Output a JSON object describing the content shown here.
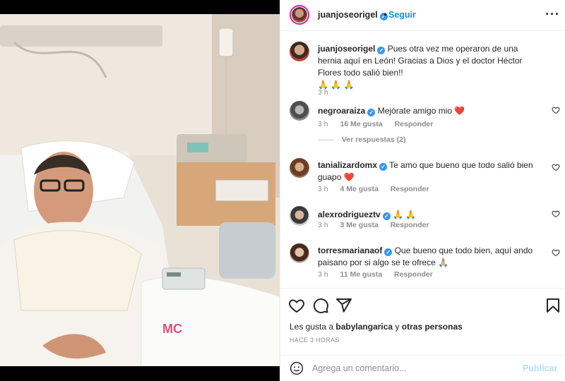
{
  "header": {
    "username": "juanjoseorigel",
    "follow_label": "Seguir",
    "more_icon": "more-horizontal-icon"
  },
  "caption": {
    "username": "juanjoseorigel",
    "text": "Pues otra vez me operaron de una hernia aquí en León! Gracias a Dios y el doctor Héctor Flores todo salió bien!!",
    "emojis": "🙏 🙏 🙏",
    "time": "3 h"
  },
  "comments": [
    {
      "username": "negroaraiza",
      "text": "Mejórate amigo mio",
      "emoji": "❤️",
      "time": "3 h",
      "likes": "16 Me gusta",
      "reply": "Responder"
    },
    {
      "username": "tanializardomx",
      "text": "Te amo que bueno que todo salió bien guapo",
      "emoji": "❤️",
      "time": "3 h",
      "likes": "4 Me gusta",
      "reply": "Responder"
    },
    {
      "username": "alexrodrigueztv",
      "text": "",
      "emoji": "🙏 🙏",
      "time": "3 h",
      "likes": "3 Me gusta",
      "reply": "Responder"
    },
    {
      "username": "torresmarianaof",
      "text": "Que bueno que todo bien, aquí ando paisano por si algo se te ofrece 🙏🏼",
      "emoji": "",
      "time": "3 h",
      "likes": "11 Me gusta",
      "reply": "Responder"
    }
  ],
  "replies_label": "Ver respuestas (2)",
  "likes_line": {
    "prefix": "Les gusta a",
    "user": "babylangarica",
    "connector": "y",
    "others": "otras personas"
  },
  "timestamp": "HACE 3 HORAS",
  "add_comment": {
    "placeholder": "Agrega un comentario...",
    "post_label": "Publicar"
  },
  "colors": {
    "accent": "#0095f6",
    "verified": "#3897f0",
    "heart": "#ed4956",
    "muted": "#8e8e8e"
  }
}
